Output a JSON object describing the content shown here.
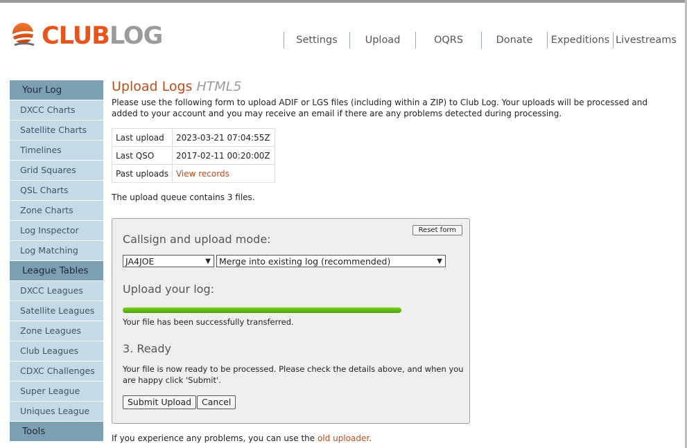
{
  "logo": {
    "part1": "CLUB",
    "part2": "LOG"
  },
  "nav": [
    "Settings",
    "Upload",
    "OQRS",
    "Donate",
    "Expeditions",
    "Livestreams"
  ],
  "sidebar": {
    "your_log": "Your Log",
    "log_items": [
      "DXCC Charts",
      "Satellite Charts",
      "Timelines",
      "Grid Squares",
      "QSL Charts",
      "Zone Charts",
      "Log Inspector",
      "Log Matching"
    ],
    "league_tables": "League Tables",
    "league_items": [
      "DXCC Leagues",
      "Satellite Leagues",
      "Zone Leagues",
      "Club Leagues",
      "CDXC Challenges",
      "Super League",
      "Uniques League"
    ],
    "tools": "Tools"
  },
  "main": {
    "title": "Upload Logs",
    "title_suffix": "HTML5",
    "intro": "Please use the following form to upload ADIF or LGS files (including within a ZIP) to Club Log. Your uploads will be processed and added to your account and you may receive an email if there are any problems detected during processing.",
    "info": {
      "last_upload_label": "Last upload",
      "last_upload_value": "2023-03-21 07:04:55Z",
      "last_qso_label": "Last QSO",
      "last_qso_value": "2017-02-11 00:20:00Z",
      "past_uploads_label": "Past uploads",
      "past_uploads_value": "View records"
    },
    "queue": "The upload queue contains 3 files."
  },
  "panel": {
    "reset": "Reset form",
    "callsign_heading": "Callsign and upload mode:",
    "callsign_value": "JA4JOE",
    "mode_value": "Merge into existing log (recommended)",
    "upload_heading": "Upload your log:",
    "progress": 1.0,
    "transfer_msg": "Your file has been successfully transferred.",
    "ready_heading": "3. Ready",
    "ready_msg": "Your file is now ready to be processed. Please check the details above, and when you are happy click 'Submit'.",
    "submit": "Submit Upload",
    "cancel": "Cancel"
  },
  "footer": {
    "text": "If you experience any problems, you can use the ",
    "link": "old uploader",
    "end": "."
  },
  "colors": {
    "accent": "#c24a16",
    "sidebar_header": "#7d9fb3",
    "sidebar_item": "#c4dbe7",
    "progress": "#5fb512"
  }
}
